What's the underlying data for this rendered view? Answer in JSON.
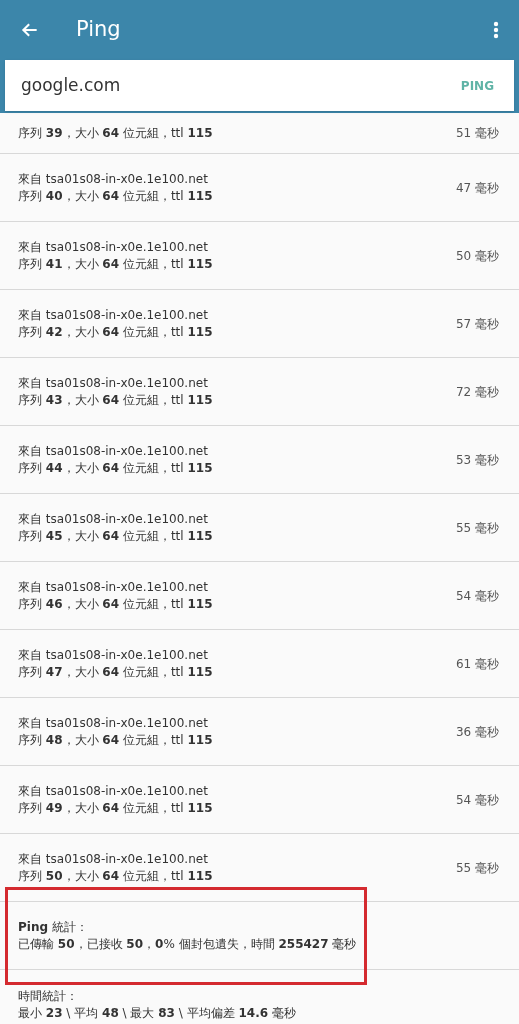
{
  "app_bar": {
    "title": "Ping"
  },
  "host_field": {
    "value": "google.com",
    "button": "PING"
  },
  "replies": [
    {
      "detail": "序列 **39**，大小 **64** 位元組，ttl **115**",
      "time": "51 毫秒"
    },
    {
      "from": "來自 tsa01s08-in-x0e.1e100.net",
      "detail": "序列 **40**，大小 **64** 位元組，ttl **115**",
      "time": "47 毫秒"
    },
    {
      "from": "來自 tsa01s08-in-x0e.1e100.net",
      "detail": "序列 **41**，大小 **64** 位元組，ttl **115**",
      "time": "50 毫秒"
    },
    {
      "from": "來自 tsa01s08-in-x0e.1e100.net",
      "detail": "序列 **42**，大小 **64** 位元組，ttl **115**",
      "time": "57 毫秒"
    },
    {
      "from": "來自 tsa01s08-in-x0e.1e100.net",
      "detail": "序列 **43**，大小 **64** 位元組，ttl **115**",
      "time": "72 毫秒"
    },
    {
      "from": "來自 tsa01s08-in-x0e.1e100.net",
      "detail": "序列 **44**，大小 **64** 位元組，ttl **115**",
      "time": "53 毫秒"
    },
    {
      "from": "來自 tsa01s08-in-x0e.1e100.net",
      "detail": "序列 **45**，大小 **64** 位元組，ttl **115**",
      "time": "55 毫秒"
    },
    {
      "from": "來自 tsa01s08-in-x0e.1e100.net",
      "detail": "序列 **46**，大小 **64** 位元組，ttl **115**",
      "time": "54 毫秒"
    },
    {
      "from": "來自 tsa01s08-in-x0e.1e100.net",
      "detail": "序列 **47**，大小 **64** 位元組，ttl **115**",
      "time": "61 毫秒"
    },
    {
      "from": "來自 tsa01s08-in-x0e.1e100.net",
      "detail": "序列 **48**，大小 **64** 位元組，ttl **115**",
      "time": "36 毫秒"
    },
    {
      "from": "來自 tsa01s08-in-x0e.1e100.net",
      "detail": "序列 **49**，大小 **64** 位元組，ttl **115**",
      "time": "54 毫秒"
    },
    {
      "from": "來自 tsa01s08-in-x0e.1e100.net",
      "detail": "序列 **50**，大小 **64** 位元組，ttl **115**",
      "time": "55 毫秒"
    }
  ],
  "ping_stats": {
    "title": "**Ping** 統計：",
    "text": "已傳輸 **50**，已接收 **50**，**0**% 個封包遺失，時間 **255427** 毫秒",
    "highlighted": true
  },
  "time_stats": {
    "title": "時間統計：",
    "text": "最小 **23** \\ 平均 **48** \\ 最大 **83** \\ 平均偏差 **14.6** 毫秒"
  }
}
